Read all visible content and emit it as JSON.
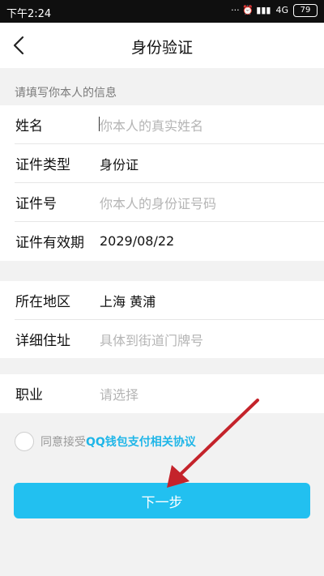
{
  "status_bar": {
    "time": "下午2:24",
    "indicators": "··· ⏰ ▮▮▮",
    "network": "4G",
    "battery": "79"
  },
  "header": {
    "title": "身份验证",
    "back_icon": "chevron-left-icon"
  },
  "form": {
    "section_hint": "请填写你本人的信息",
    "name": {
      "label": "姓名",
      "placeholder": "你本人的真实姓名"
    },
    "id_type": {
      "label": "证件类型",
      "value": "身份证"
    },
    "id_number": {
      "label": "证件号",
      "placeholder": "你本人的身份证号码"
    },
    "id_expiry": {
      "label": "证件有效期",
      "value": "2029/08/22"
    },
    "region": {
      "label": "所在地区",
      "value": "上海 黄浦"
    },
    "address": {
      "label": "详细住址",
      "placeholder": "具体到街道门牌号"
    },
    "occupation": {
      "label": "职业",
      "placeholder": "请选择"
    }
  },
  "agreement": {
    "prefix": "同意接受",
    "link": "QQ钱包支付相关协议"
  },
  "next_button": {
    "label": "下一步"
  },
  "colors": {
    "accent": "#22c0f0",
    "link": "#1fb6e8",
    "annotation_arrow": "#c4232b"
  }
}
